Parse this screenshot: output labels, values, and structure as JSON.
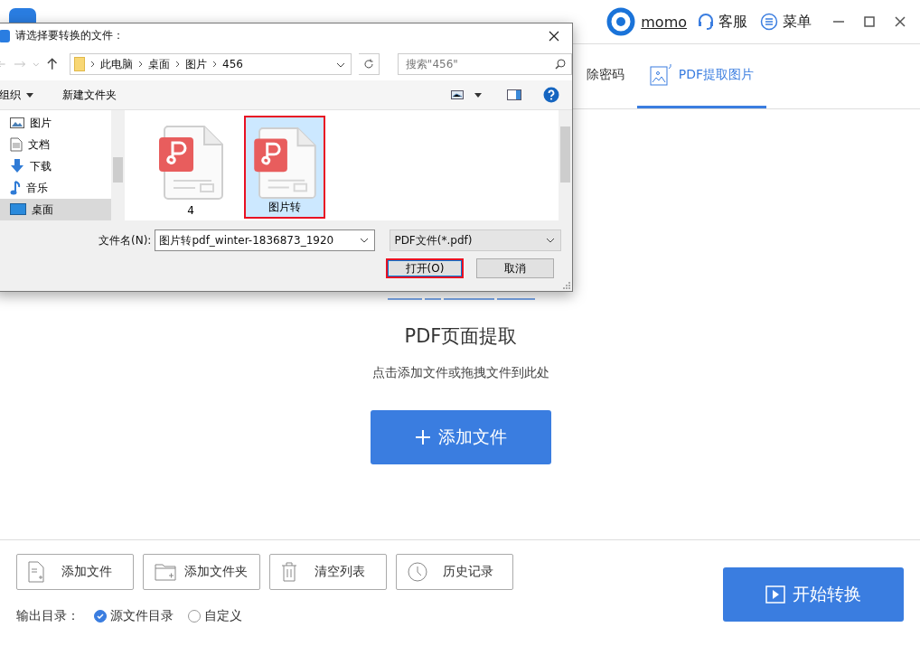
{
  "app": {
    "user": "momo",
    "support": "客服",
    "menu": "菜单"
  },
  "tabs": [
    {
      "label": "除密码",
      "selected": false
    },
    {
      "label": "PDF提取图片",
      "selected": true
    }
  ],
  "extract": {
    "title": "PDF页面提取",
    "hint": "点击添加文件或拖拽文件到此处",
    "add_button": "添加文件"
  },
  "toolbar": [
    {
      "label": "添加文件",
      "kind": "file"
    },
    {
      "label": "添加文件夹",
      "kind": "folder"
    },
    {
      "label": "清空列表",
      "kind": "trash"
    },
    {
      "label": "历史记录",
      "kind": "clock"
    }
  ],
  "output": {
    "label": "输出目录：",
    "options": [
      {
        "label": "源文件目录",
        "selected": true
      },
      {
        "label": "自定义",
        "selected": false
      }
    ]
  },
  "start_button": "开始转换",
  "dialog": {
    "title": "请选择要转换的文件：",
    "path": [
      "此电脑",
      "桌面",
      "图片",
      "456"
    ],
    "search_placeholder": "搜索\"456\"",
    "organize": "组织",
    "new_folder": "新建文件夹",
    "nav": [
      {
        "label": "图片",
        "kind": "pictures",
        "selected": false
      },
      {
        "label": "文档",
        "kind": "documents",
        "selected": false
      },
      {
        "label": "下载",
        "kind": "downloads",
        "selected": false
      },
      {
        "label": "音乐",
        "kind": "music",
        "selected": false
      },
      {
        "label": "桌面",
        "kind": "desktop",
        "selected": true
      }
    ],
    "files": [
      {
        "name": "4",
        "selected": false,
        "highlighted": false
      },
      {
        "name": "图片转",
        "selected": true,
        "highlighted": true
      }
    ],
    "filename_label": "文件名(N):",
    "filename": "图片转pdf_winter-1836873_1920",
    "filter": "PDF文件(*.pdf)",
    "open_button": {
      "label": "打开(O)",
      "highlighted": true
    },
    "cancel_button": "取消"
  }
}
